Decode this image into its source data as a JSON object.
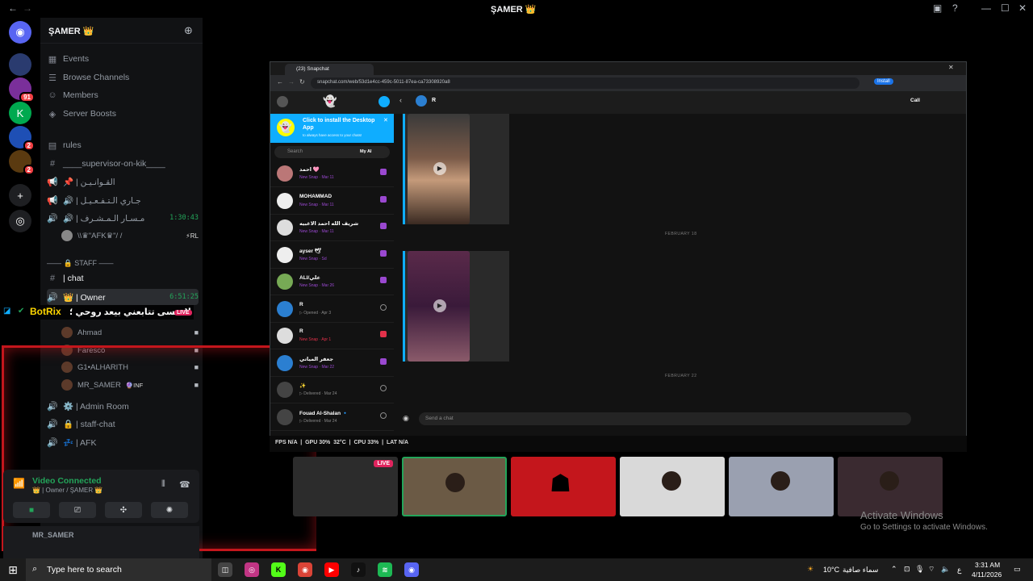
{
  "window": {
    "title": "ŞAMER 👑",
    "nav_back": "←",
    "nav_fwd": "→"
  },
  "server_rail": [
    {
      "name": "Discord Home",
      "icon": "discord-icon",
      "color": "#5865f2",
      "badge": ""
    },
    {
      "name": "Server 1",
      "icon": "server-avatar",
      "color": "#2a3b6f",
      "badge": ""
    },
    {
      "name": "Server 2",
      "icon": "server-avatar",
      "color": "#7a2f9a",
      "badge": "91"
    },
    {
      "name": "Kick",
      "icon": "kick-icon",
      "color": "#00a94f",
      "badge": ""
    },
    {
      "name": "Server 4",
      "icon": "server-avatar",
      "color": "#1e4fb5",
      "badge": "2"
    },
    {
      "name": "Server 5",
      "icon": "server-avatar",
      "color": "#5a3a10",
      "badge": "2"
    }
  ],
  "server": {
    "name": "ŞAMER 👑"
  },
  "channels": {
    "items": [
      {
        "icon": "calendar-icon",
        "label": "Events"
      },
      {
        "icon": "browse-icon",
        "label": "Browse Channels"
      },
      {
        "icon": "members-icon",
        "label": "Members"
      },
      {
        "icon": "boost-icon",
        "label": "Server Boosts"
      },
      {
        "icon": "rules-icon",
        "label": "rules"
      },
      {
        "icon": "hash-icon",
        "label": "____supervisor-on-kik____"
      },
      {
        "icon": "megaphone-icon",
        "label": "📌 | القـوانـيـن"
      },
      {
        "icon": "megaphone-icon",
        "label": "🔊 | جـاري الـتـفـعـيـل"
      },
      {
        "icon": "speaker-icon",
        "label": "🔊 | مـسـار الـمـشـرف",
        "time": "1:30:43"
      }
    ],
    "afk_user": "\\\\♛\"AFK♛\"/ /",
    "afk_tag": "⚡RL",
    "staff_category": "—— 🔒 STAFF ——",
    "chat": "| chat",
    "owner_channel": "👑 | Owner",
    "owner_time": "6:51:25",
    "voice_users": [
      {
        "name": "Ahmad"
      },
      {
        "name": "Farescö"
      },
      {
        "name": "G1•ALHARITH"
      },
      {
        "name": "MR_SAMER",
        "tag": "🔮INF"
      }
    ],
    "after": [
      {
        "icon": "speaker-icon",
        "label": "⚙️ | Admin Room"
      },
      {
        "icon": "speaker-icon",
        "label": "🔒 | staff-chat"
      },
      {
        "icon": "speaker-icon",
        "label": "💤 | AFK"
      }
    ]
  },
  "overlay": {
    "bot": "BotRix",
    "message": "لا تنسى تتابعني بيعد روحي ؛",
    "live": "LIVE"
  },
  "voice_panel": {
    "status": "Video Connected",
    "sub": "👑 | Owner / ŞAMER 👑"
  },
  "user_panel": {
    "name": "MR_SAMER"
  },
  "snapchat": {
    "tab": "(23) Snapchat",
    "url": "snapchat.com/web/53d1e4cc-459c-5011-87ea-ca73308920a8",
    "install": "Install",
    "call": "Call",
    "active_chat": "R",
    "banner_title": "Click to install the Desktop App",
    "banner_sub": "to always have access to your chats!",
    "search": "Search",
    "my_ai": "My AI",
    "send_placeholder": "Send a chat",
    "dates": [
      "FEBRUARY 18",
      "FEBRUARY 22"
    ],
    "chats": [
      {
        "name": "احمد 🩷",
        "status": "New Snap · Mar 11",
        "icon": "snap",
        "color": "#9a48d0"
      },
      {
        "name": "MOHAMMAD",
        "status": "New Snap · Mar 11",
        "icon": "snap",
        "color": "#9a48d0"
      },
      {
        "name": "شريف الله احمد الاغبيه",
        "status": "New Snap · Mar 11",
        "icon": "snap",
        "color": "#9a48d0"
      },
      {
        "name": "ayser 🕊",
        "status": "New Snap · Sd",
        "icon": "snap",
        "color": "#9a48d0"
      },
      {
        "name": "ALI/علي",
        "status": "New Snap · Mar 26",
        "icon": "snap",
        "color": "#9a48d0"
      },
      {
        "name": "R",
        "status": "▷ Opened · Apr 3",
        "icon": "opened",
        "color": "#8a8a8a"
      },
      {
        "name": "R",
        "status": "New Snap · Apr 1",
        "icon": "snap",
        "color": "#e2314a"
      },
      {
        "name": "جعفر المياتي",
        "status": "New Snap · Mar 22",
        "icon": "snap",
        "color": "#9a48d0"
      },
      {
        "name": "✨",
        "status": "▷ Delivered · Mar 24",
        "icon": "opened",
        "color": "#8a8a8a"
      },
      {
        "name": "Fouad Al-Shalan 🔹",
        "status": "▷ Delivered · Mar 24",
        "icon": "opened",
        "color": "#8a8a8a"
      }
    ]
  },
  "stats": {
    "fps": "N/A",
    "gpu": "30%  32°C",
    "cpu": "33%",
    "lat": "N/A"
  },
  "stream_tiles": [
    {
      "name": "stream-tile-1",
      "live": "LIVE",
      "bg": "#2c2c2c"
    },
    {
      "name": "stream-tile-2",
      "bg": "#6b5a45"
    },
    {
      "name": "stream-tile-3",
      "bg": "#c4161c"
    },
    {
      "name": "stream-tile-4",
      "bg": "#d9d9d9"
    },
    {
      "name": "stream-tile-5",
      "bg": "#9aa0b0"
    },
    {
      "name": "stream-tile-6",
      "bg": "#3a2a30"
    }
  ],
  "watermark": {
    "line1": "Activate Windows",
    "line2": "Go to Settings to activate Windows."
  },
  "taskbar": {
    "search": "Type here to search",
    "temp": "10°C",
    "weather": "سماء صافية",
    "lang": "ع",
    "time": "3:31 AM",
    "date": "4/11/2026"
  }
}
